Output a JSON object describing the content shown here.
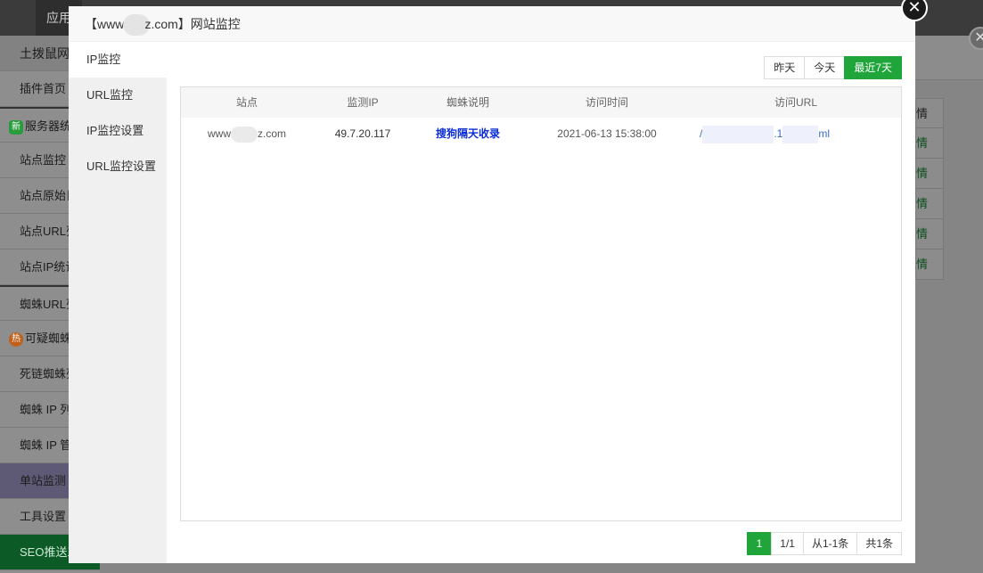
{
  "background": {
    "top_tab": "应用",
    "sidebar": [
      {
        "label": "土拨鼠网",
        "kind": "first"
      },
      {
        "label": "插件首页"
      },
      {
        "label": "服务器统",
        "badge": "新",
        "badge_color": "#2a9c3d"
      },
      {
        "label": "站点监控"
      },
      {
        "label": "站点原始日"
      },
      {
        "label": "站点URL列"
      },
      {
        "label": "站点IP统计"
      },
      {
        "label": "蜘蛛URL列"
      },
      {
        "label": "可疑蜘蛛",
        "badge": "热",
        "badge_color": "#c0601a"
      },
      {
        "label": "死链蜘蛛列"
      },
      {
        "label": "蜘蛛 IP 列"
      },
      {
        "label": "蜘蛛 IP 管"
      },
      {
        "label": "单站监测",
        "kind": "active"
      },
      {
        "label": "工具设置"
      },
      {
        "label": "SEO推送工",
        "kind": "green"
      }
    ],
    "table_head": "情",
    "table_cells": [
      "情",
      "情",
      "情",
      "情",
      "情"
    ]
  },
  "modal": {
    "title_prefix": "【www.",
    "title_suffix": "z.com】网站监控",
    "close_glyph": "✕",
    "tabs": [
      "IP监控",
      "URL监控",
      "IP监控设置",
      "URL监控设置"
    ],
    "active_tab": 0,
    "range_buttons": [
      "昨天",
      "今天",
      "最近7天"
    ],
    "active_range": 2,
    "columns": [
      "站点",
      "监测IP",
      "蜘蛛说明",
      "访问时间",
      "访问URL"
    ],
    "rows": [
      {
        "site_prefix": "www",
        "site_suffix": "z.com",
        "ip": "49.7.20.117",
        "spider": "搜狗隔天收录",
        "time": "2021-06-13 15:38:00",
        "url_prefix": "/",
        "url_mid": ".1",
        "url_suffix": "ml"
      }
    ],
    "pager": {
      "current": "1",
      "pages": "1/1",
      "range": "从1-1条",
      "total": "共1条"
    }
  },
  "colors": {
    "accent": "#20a53a",
    "spider_link": "#0b2cd2",
    "url_link": "#3a6fc0"
  }
}
